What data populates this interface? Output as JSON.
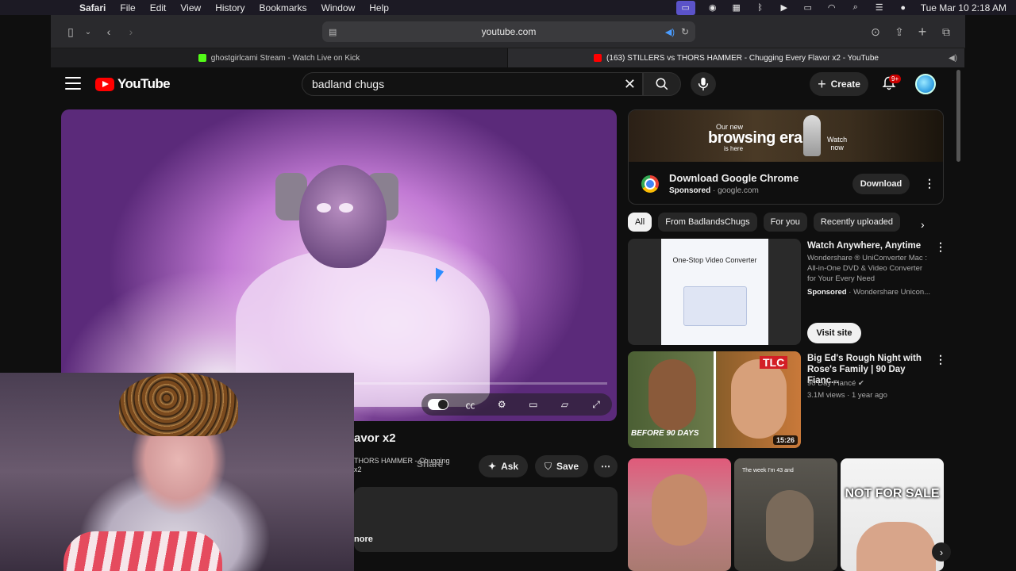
{
  "menubar": {
    "app": "Safari",
    "items": [
      "File",
      "Edit",
      "View",
      "History",
      "Bookmarks",
      "Window",
      "Help"
    ],
    "clock": "Tue Mar 10  2:18 AM"
  },
  "safari": {
    "address": "youtube.com",
    "tabs": [
      {
        "title": "ghostgirlcami Stream - Watch Live on Kick",
        "favicon_color": "#53fc18"
      },
      {
        "title": "(163) STILLERS vs THORS HAMMER - Chugging Every Flavor x2 - YouTube",
        "favicon_color": "#ff0000"
      }
    ]
  },
  "youtube": {
    "logo_text": "YouTube",
    "search_value": "badland chugs",
    "create_label": "Create",
    "notif_badge": "9+"
  },
  "player": {
    "progress": 0.0
  },
  "video": {
    "title_fragment": "avor x2",
    "channel_fragment": "THORS HAMMER - Chugging",
    "channel_fragment2": "x2",
    "share_label": "Share",
    "ask_label": "Ask",
    "save_label": "Save",
    "desc_more": "nore"
  },
  "ad": {
    "banner_small": "Our new",
    "banner_big": "browsing era",
    "banner_is": "is here",
    "banner_watch": "Watch",
    "banner_now": "now",
    "title": "Download Google Chrome",
    "sponsored": "Sponsored",
    "domain": "· google.com",
    "button": "Download"
  },
  "chips": [
    "All",
    "From BadlandsChugs",
    "For you",
    "Recently uploaded"
  ],
  "recs": [
    {
      "title": "Watch Anywhere, Anytime",
      "desc1": "Wondershare ® UniConverter Mac :",
      "desc2": "All-in-One DVD & Video Converter",
      "desc3": "for Your Every Need",
      "sponsored": "Sponsored",
      "advertiser": "· Wondershare Unicon...",
      "cta": "Visit site",
      "thumb_text": "One-Stop Video Converter"
    },
    {
      "title": "Big Ed's Rough Night with Rose's Family | 90 Day Fianc...",
      "channel": "90 Day Fiancé",
      "meta": "3.1M views · 1 year ago",
      "duration": "15:26",
      "tlc": "TLC",
      "thumb_caption": "BEFORE 90 DAYS"
    }
  ],
  "shorts": {
    "s2_caption": "The week I'm 43 and",
    "s3_caption": "NOT FOR SALE"
  }
}
